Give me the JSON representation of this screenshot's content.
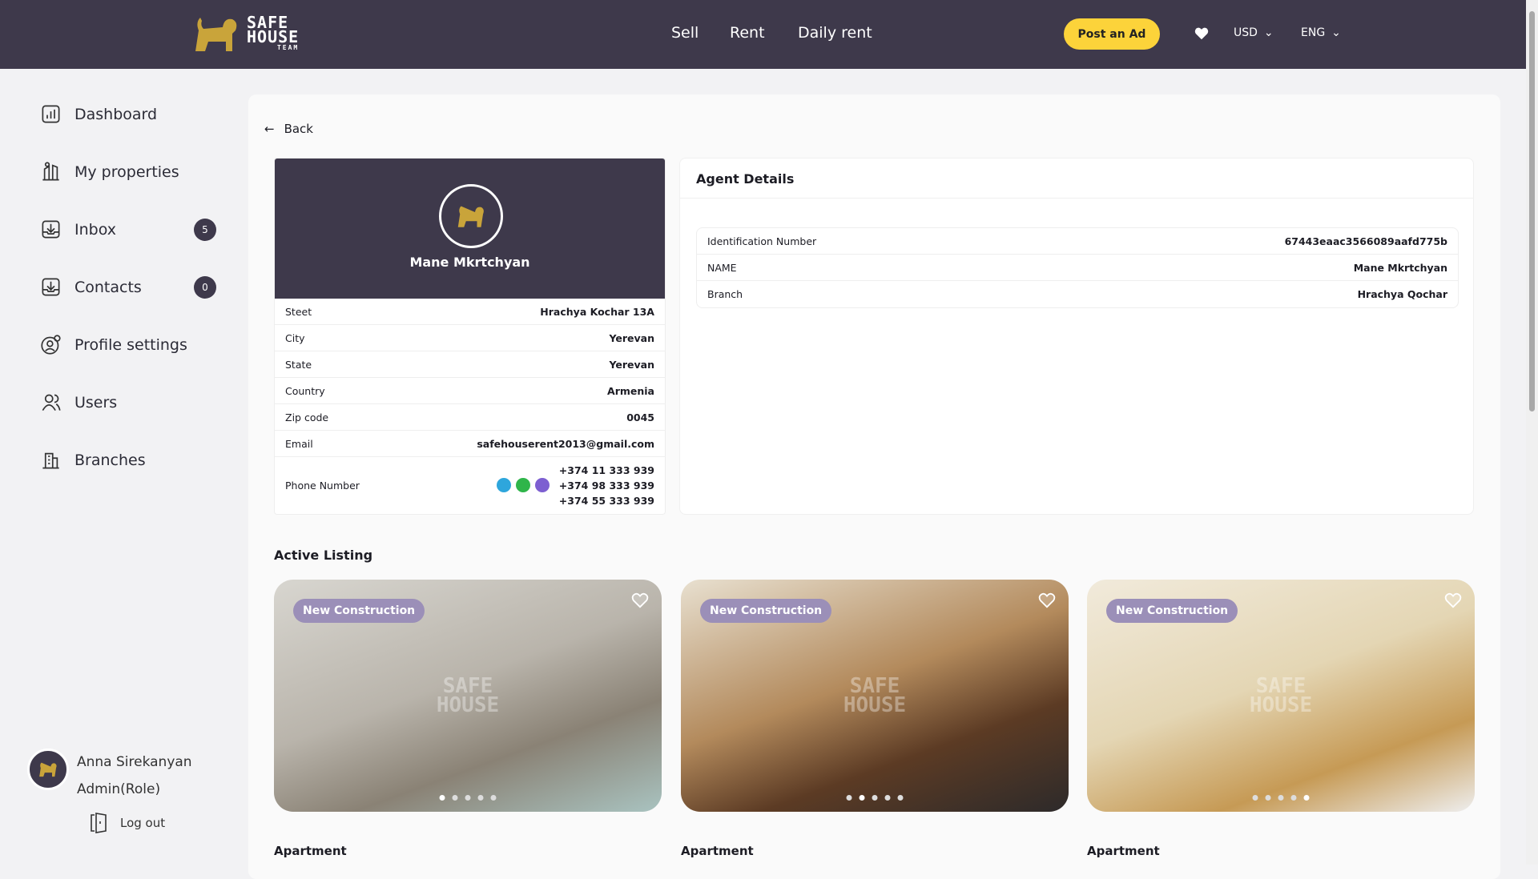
{
  "header": {
    "logo_text": "SAFE HOUSE TEAM",
    "nav": [
      "Sell",
      "Rent",
      "Daily rent"
    ],
    "post_ad": "Post an Ad",
    "currency": "USD",
    "language": "ENG"
  },
  "sidebar": {
    "items": [
      {
        "label": "Dashboard",
        "icon": "chart-icon"
      },
      {
        "label": "My properties",
        "icon": "buildings-icon"
      },
      {
        "label": "Inbox",
        "icon": "inbox-icon",
        "badge": "5"
      },
      {
        "label": "Contacts",
        "icon": "contacts-icon",
        "badge": "0"
      },
      {
        "label": "Profile settings",
        "icon": "user-gear-icon"
      },
      {
        "label": "Users",
        "icon": "users-icon"
      },
      {
        "label": "Branches",
        "icon": "branch-icon"
      }
    ],
    "user": {
      "name": "Anna Sirekanyan",
      "role": "Admin(Role)"
    },
    "logout": "Log out"
  },
  "main": {
    "back": "Back",
    "profile": {
      "name": "Mane Mkrtchyan",
      "rows": [
        {
          "label": "Steet",
          "value": "Hrachya Kochar 13A"
        },
        {
          "label": "City",
          "value": "Yerevan"
        },
        {
          "label": "State",
          "value": "Yerevan"
        },
        {
          "label": "Country",
          "value": "Armenia"
        },
        {
          "label": "Zip code",
          "value": "0045"
        },
        {
          "label": "Email",
          "value": "safehouserent2013@gmail.com"
        }
      ],
      "phone_label": "Phone Number",
      "phones": [
        "+374 11 333 939",
        "+374 98 333 939",
        "+374 55 333 939"
      ]
    },
    "agent": {
      "title": "Agent Details",
      "rows": [
        {
          "label": "Identification Number",
          "value": "67443eaac3566089aafd775b"
        },
        {
          "label": "NAME",
          "value": "Mane Mkrtchyan"
        },
        {
          "label": "Branch",
          "value": "Hrachya Qochar"
        }
      ]
    },
    "listing_title": "Active Listing",
    "listings": [
      {
        "tag": "New Construction",
        "type": "Apartment",
        "active_dot": 0
      },
      {
        "tag": "New Construction",
        "type": "Apartment",
        "active_dot": 1
      },
      {
        "tag": "New Construction",
        "type": "Apartment",
        "active_dot": 4
      }
    ]
  },
  "colors": {
    "header": "#3e394b",
    "accent": "#fcd33a",
    "tag": "#9b8fb8"
  }
}
